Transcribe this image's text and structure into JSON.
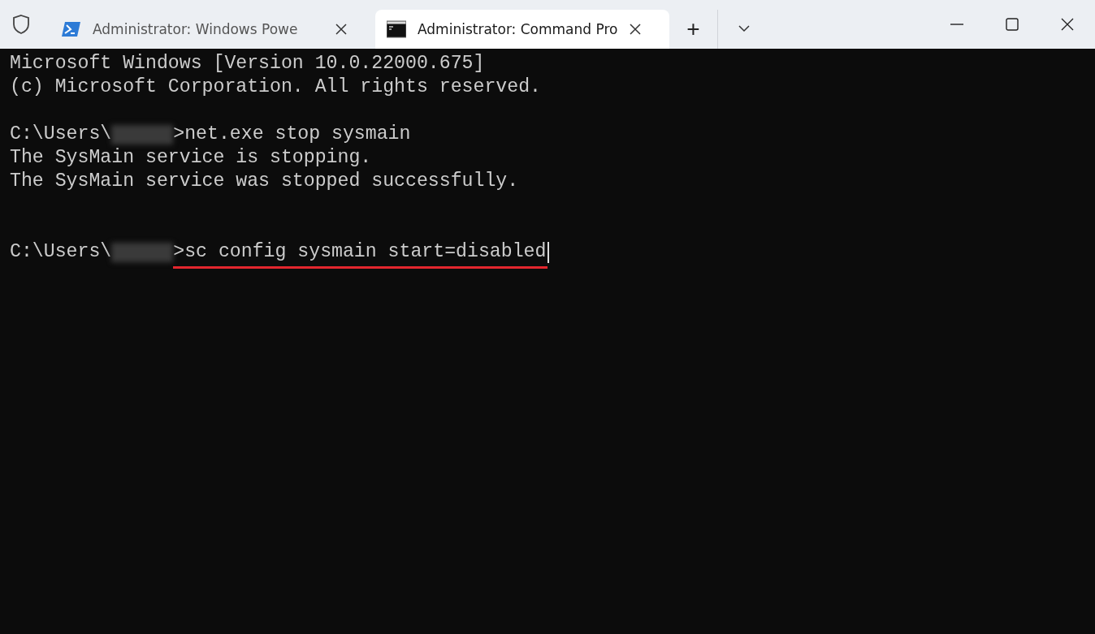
{
  "tabs": [
    {
      "title": "Administrator: Windows Powe",
      "kind": "powershell",
      "selected": false
    },
    {
      "title": "Administrator: Command Pro",
      "kind": "cmd",
      "selected": true
    }
  ],
  "new_tab_button": "+",
  "terminal": {
    "lines": [
      {
        "kind": "output",
        "text": "Microsoft Windows [Version 10.0.22000.675]"
      },
      {
        "kind": "output",
        "text": "(c) Microsoft Corporation. All rights reserved."
      },
      {
        "kind": "blank"
      },
      {
        "kind": "prompt",
        "path": "C:\\Users\\",
        "redacted": true,
        "command": ">net.exe stop sysmain",
        "underlined": false,
        "cursor": false
      },
      {
        "kind": "output",
        "text": "The SysMain service is stopping."
      },
      {
        "kind": "output",
        "text": "The SysMain service was stopped successfully."
      },
      {
        "kind": "blank"
      },
      {
        "kind": "blank"
      },
      {
        "kind": "prompt",
        "path": "C:\\Users\\",
        "redacted": true,
        "command": ">sc config sysmain start=disabled",
        "underlined": true,
        "cursor": true
      }
    ]
  }
}
